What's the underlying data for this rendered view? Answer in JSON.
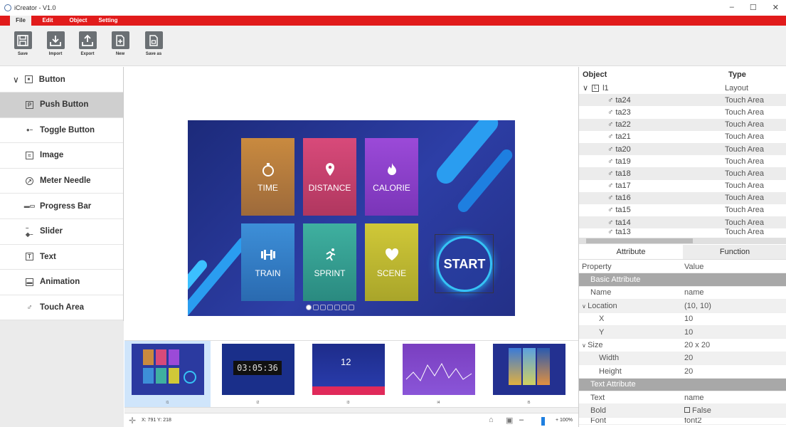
{
  "window": {
    "title": "iCreator - V1.0",
    "minimize": "–",
    "maximize": "☐",
    "close": "✕"
  },
  "menu": [
    {
      "label": "File"
    },
    {
      "label": "Edit"
    },
    {
      "label": "Object"
    },
    {
      "label": "Setting"
    }
  ],
  "toolbar": {
    "save": "Save",
    "import": "Import",
    "export": "Export",
    "new": "New",
    "save_as": "Save as"
  },
  "sidebar": {
    "header": "Button",
    "items": [
      {
        "label": "Push Button",
        "icon": "push-button-icon"
      },
      {
        "label": "Toggle Button",
        "icon": "toggle-icon"
      },
      {
        "label": "Image",
        "icon": "image-icon"
      },
      {
        "label": "Meter Needle",
        "icon": "meter-icon"
      },
      {
        "label": "Progress Bar",
        "icon": "progress-icon"
      },
      {
        "label": "Slider",
        "icon": "slider-icon"
      },
      {
        "label": "Text",
        "icon": "text-icon"
      },
      {
        "label": "Animation",
        "icon": "animation-icon"
      },
      {
        "label": "Touch Area",
        "icon": "touch-icon"
      }
    ]
  },
  "screen": {
    "tiles": [
      {
        "label": "TIME"
      },
      {
        "label": "DISTANCE"
      },
      {
        "label": "CALORIE"
      },
      {
        "label": "TRAIN"
      },
      {
        "label": "SPRINT"
      },
      {
        "label": "SCENE"
      }
    ],
    "start": "START"
  },
  "thumbs": [
    {
      "label": "l1",
      "timer": ""
    },
    {
      "label": "l2",
      "timer": "03:05:36"
    },
    {
      "label": "l3",
      "timer": "12"
    },
    {
      "label": "l4",
      "timer": ""
    },
    {
      "label": "l5",
      "timer": ""
    }
  ],
  "status": {
    "coords": "X: 791 Y: 218",
    "zoom": "+ 100%",
    "minus": "–"
  },
  "tree": {
    "col_object": "Object",
    "col_type": "Type",
    "root": {
      "name": "l1",
      "type": "Layout"
    },
    "rows": [
      {
        "name": "ta24",
        "type": "Touch Area"
      },
      {
        "name": "ta23",
        "type": "Touch Area"
      },
      {
        "name": "ta22",
        "type": "Touch Area"
      },
      {
        "name": "ta21",
        "type": "Touch Area"
      },
      {
        "name": "ta20",
        "type": "Touch Area"
      },
      {
        "name": "ta19",
        "type": "Touch Area"
      },
      {
        "name": "ta18",
        "type": "Touch Area"
      },
      {
        "name": "ta17",
        "type": "Touch Area"
      },
      {
        "name": "ta16",
        "type": "Touch Area"
      },
      {
        "name": "ta15",
        "type": "Touch Area"
      },
      {
        "name": "ta14",
        "type": "Touch Area"
      },
      {
        "name": "ta13",
        "type": "Touch Area"
      }
    ]
  },
  "tabs": {
    "attribute": "Attribute",
    "function": "Function"
  },
  "props": {
    "col_property": "Property",
    "col_value": "Value",
    "basic": "Basic Attribute",
    "name_k": "Name",
    "name_v": "name",
    "loc_k": "Location",
    "loc_v": "(10, 10)",
    "x_k": "X",
    "x_v": "10",
    "y_k": "Y",
    "y_v": "10",
    "size_k": "Size",
    "size_v": "20 x 20",
    "w_k": "Width",
    "w_v": "20",
    "h_k": "Height",
    "h_v": "20",
    "text_attr": "Text Attribute",
    "text_k": "Text",
    "text_v": "name",
    "bold_k": "Bold",
    "bold_v": "False",
    "font_k": "Font",
    "font_v": "font2"
  }
}
